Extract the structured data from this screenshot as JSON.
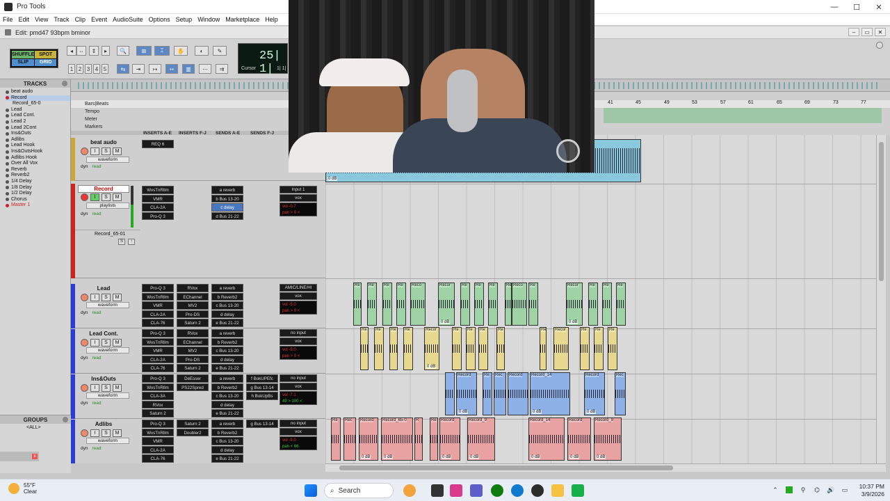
{
  "window": {
    "title": "Pro Tools"
  },
  "menu": [
    "File",
    "Edit",
    "View",
    "Track",
    "Clip",
    "Event",
    "AudioSuite",
    "Options",
    "Setup",
    "Window",
    "Marketplace",
    "Help"
  ],
  "edit_window": {
    "title": "Edit: pmd47 93bpm bminor"
  },
  "modes": {
    "shuffle": "SHUFFLE",
    "spot": "SPOT",
    "slip": "SLIP",
    "grid": "GRID"
  },
  "counter": {
    "main": "25| 1|",
    "label": "Cursor",
    "value": "1| 1|"
  },
  "zoom_presets": [
    "1",
    "2",
    "3",
    "4",
    "5"
  ],
  "panels": {
    "tracks": "TRACKS",
    "groups": "GROUPS",
    "all_group": "<ALL>"
  },
  "track_list": [
    "beat audo",
    "Record",
    "Record_65-0",
    "Lead",
    "Lead Cont.",
    "Lead 2",
    "Lead 2Cont",
    "Ins&Outs",
    "Adlibs",
    "Lead Hook",
    "Ins&OutsHook",
    "Adlibs Hook",
    "Over All Vox",
    "Reverb",
    "Reverb2",
    "1/4 Delay",
    "1/8 Delay",
    "1/2 Delay",
    "Chorus",
    "Master 1"
  ],
  "rulers": [
    "Bars|Beats",
    "Tempo",
    "Meter",
    "Markers"
  ],
  "bar_numbers": [
    "41",
    "45",
    "49",
    "53",
    "57",
    "61",
    "65",
    "69",
    "73",
    "77"
  ],
  "column_headers": {
    "inserts_ae": "INSERTS A-E",
    "inserts_fj": "INSERTS F-J",
    "sends_ae": "SENDS A-E",
    "sends_fj": "SENDS F-J"
  },
  "tracks": [
    {
      "name": "beat audo",
      "view": "waveform",
      "dyn": "dyn",
      "read": "read",
      "inserts": [
        "REQ 6"
      ],
      "inserts2": [],
      "sends": [],
      "sends2": [],
      "io": [],
      "vol": "",
      "pan": ""
    },
    {
      "name": "Record",
      "view": "playlists",
      "dyn": "dyn",
      "read": "read",
      "inserts": [
        "WvsTnRllm",
        "VMR",
        "CLA-2A",
        "Pro-Q 3"
      ],
      "inserts2": [],
      "sends": [
        "a reverb",
        "b Bus 13-20",
        "c delay",
        "d Bus 21-22"
      ],
      "sends2": [],
      "io": [
        "Input 1",
        "vox"
      ],
      "vol": "vol -0.7",
      "pan": "pan > 0 <",
      "sub": "Record_65-01"
    },
    {
      "name": "Lead",
      "view": "waveform",
      "dyn": "dyn",
      "read": "read",
      "inserts": [
        "Pro-Q 3",
        "WvsTnRllm",
        "VMR",
        "CLA-2A",
        "CLA-76"
      ],
      "inserts2": [
        "RVox",
        "EChannel",
        "MV2",
        "Pro-DS",
        "Saturn 2"
      ],
      "sends": [
        "a reverb",
        "b Reverb2",
        "c Bus 13-20",
        "d delay",
        "e Bus 21-22"
      ],
      "sends2": [],
      "io": [
        "AMIC/LINE/HI",
        "vox"
      ],
      "vol": "vol -5.0",
      "pan": "pan > 0 <"
    },
    {
      "name": "Lead Cont.",
      "view": "waveform",
      "dyn": "dyn",
      "read": "read",
      "inserts": [
        "Pro-Q 3",
        "WvsTnRllm",
        "VMR",
        "CLA-2A",
        "CLA-76"
      ],
      "inserts2": [
        "RVox",
        "EChannel",
        "MV2",
        "Pro-DS",
        "Saturn 2"
      ],
      "sends": [
        "a reverb",
        "b Reverb2",
        "c Bus 13-20",
        "d delay",
        "e Bus 21-22"
      ],
      "sends2": [],
      "io": [
        "no input",
        "vox"
      ],
      "vol": "vol -5.0",
      "pan": "pan > 0 <"
    },
    {
      "name": "Ins&Outs",
      "view": "waveform",
      "dyn": "dyn",
      "read": "read",
      "inserts": [
        "Pro-Q 3",
        "WvsTnRllm",
        "CLA-3A",
        "RVox",
        "Saturn 2"
      ],
      "inserts2": [
        "DeEsser",
        "PS22Spred"
      ],
      "sends": [
        "a reverb",
        "b Reverb2",
        "c Bus 13-20",
        "d delay",
        "e Bus 21-22"
      ],
      "sends2": [
        "f BokUPEfc",
        "g Bus 13-14",
        "h BokUpBs"
      ],
      "io": [
        "no input",
        "vox"
      ],
      "vol": "vol -7.1",
      "pan": "49 > 100 <"
    },
    {
      "name": "Adlibs",
      "view": "waveform",
      "dyn": "dyn",
      "read": "read",
      "inserts": [
        "Pro-Q 3",
        "WvsTnRllm",
        "VMR",
        "CLA-2A",
        "CLA-76"
      ],
      "inserts2": [
        "Saturn 2",
        "Doubler2"
      ],
      "sends": [
        "a reverb",
        "b Reverb2",
        "c Bus 13-20",
        "d delay",
        "e Bus 21-22"
      ],
      "sends2": [
        "g Bus 13-14"
      ],
      "io": [
        "no input",
        "vox"
      ],
      "vol": "vol -9.0",
      "pan": "pan < 66"
    }
  ],
  "clips": {
    "top": [
      "0 dB"
    ],
    "lead": [
      "Re",
      "Re",
      "Re",
      "Re",
      "Reco",
      "Recor",
      "Re",
      "Re",
      "Re",
      "Re",
      "Reco",
      "Re",
      "Recor",
      "Re",
      "Re",
      "Re"
    ],
    "lead_cont": [
      "Re",
      "Re",
      "Re",
      "Re",
      "Re",
      "Recor",
      "Re",
      "Re",
      "Re",
      "Re",
      "Re",
      "Recor",
      "Re",
      "Re",
      "Re"
    ],
    "ins": [
      "Record",
      "Re",
      "Rec",
      "Record",
      "Record_14",
      "Record",
      "Rec"
    ],
    "adlibs": [
      "Re",
      "Rec",
      "Record",
      "Record_65-0",
      "R",
      "Re",
      "Record",
      "Record_9",
      "Record_14",
      "Record",
      "Record_9"
    ],
    "db": "0 dB"
  },
  "taskbar": {
    "weather_temp": "55°F",
    "weather_desc": "Clear",
    "search": "Search",
    "time": "10:37 PM",
    "date": "3/9/2026"
  },
  "colors": {
    "green": "#9fd3a6",
    "yellow": "#e6d98f",
    "blue": "#8db1e6",
    "red": "#e8a2a2",
    "record_red": "#cc2222"
  }
}
